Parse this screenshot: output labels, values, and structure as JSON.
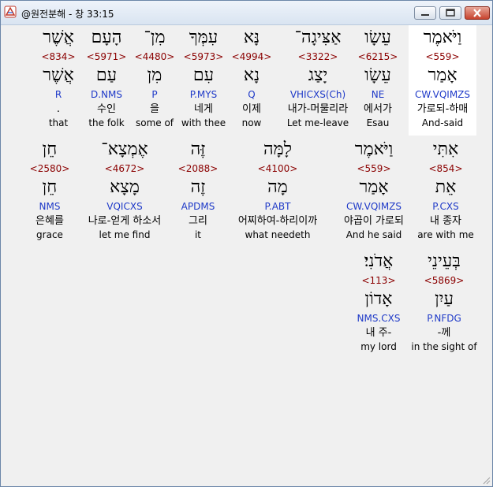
{
  "window": {
    "title": "@원전분해 - 창 33:15"
  },
  "rows": [
    {
      "words": [
        {
          "hebrew": "וַיֹּאמֶר",
          "strong": "<559>",
          "lemma": "אָמַר",
          "morph": "CW.VQIMZS",
          "korean": "가로되-하매",
          "english": "And-said",
          "highlight": true
        },
        {
          "hebrew": "עֵשָׂו",
          "strong": "<6215>",
          "lemma": "עֵשָׂו",
          "morph": "NE",
          "korean": "에서가",
          "english": "Esau",
          "highlight": false
        },
        {
          "hebrew": "אַצִּיגָה־",
          "strong": "<3322>",
          "lemma": "יָצַג",
          "morph": "VHICXS(Ch)",
          "korean": "내가-머물리라",
          "english": "Let me-leave",
          "highlight": false
        },
        {
          "hebrew": "נָּא",
          "strong": "<4994>",
          "lemma": "נָא",
          "morph": "Q",
          "korean": "이제",
          "english": "now",
          "highlight": false
        },
        {
          "hebrew": "עִמְּךָ",
          "strong": "<5973>",
          "lemma": "עִם",
          "morph": "P.MYS",
          "korean": "네게",
          "english": "with thee",
          "highlight": false
        },
        {
          "hebrew": "מִן־",
          "strong": "<4480>",
          "lemma": "מִן",
          "morph": "P",
          "korean": "을",
          "english": "some of",
          "highlight": false
        },
        {
          "hebrew": "הָעָם",
          "strong": "<5971>",
          "lemma": "עַם",
          "morph": "D.NMS",
          "korean": "수인",
          "english": "the folk",
          "highlight": false
        },
        {
          "hebrew": "אֲשֶׁר",
          "strong": "<834>",
          "lemma": "אֲשֶׁר",
          "morph": "R",
          "korean": ".",
          "english": "that",
          "highlight": false
        }
      ]
    },
    {
      "words": [
        {
          "hebrew": "אִתִּי",
          "strong": "<854>",
          "lemma": "אֵת",
          "morph": "P.CXS",
          "korean": "내 종자",
          "english": "are with me",
          "highlight": false
        },
        {
          "hebrew": "וַיֹּאמֶר",
          "strong": "<559>",
          "lemma": "אָמַר",
          "morph": "CW.VQIMZS",
          "korean": "야곱이 가로되",
          "english": "And he said",
          "highlight": false
        },
        {
          "hebrew": "לָמָּה",
          "strong": "<4100>",
          "lemma": "מָה",
          "morph": "P.ABT",
          "korean": "어찌하여-하리이까",
          "english": "what needeth",
          "highlight": false
        },
        {
          "hebrew": "זֶּה",
          "strong": "<2088>",
          "lemma": "זֶה",
          "morph": "APDMS",
          "korean": "그리",
          "english": "it",
          "highlight": false
        },
        {
          "hebrew": "אֶמְצָא־",
          "strong": "<4672>",
          "lemma": "מָצָא",
          "morph": "VQICXS",
          "korean": "나로-얻게 하소서",
          "english": "let me find",
          "highlight": false
        },
        {
          "hebrew": "חֵן",
          "strong": "<2580>",
          "lemma": "חֵן",
          "morph": "NMS",
          "korean": "은혜를",
          "english": "grace",
          "highlight": false
        }
      ]
    },
    {
      "words": [
        {
          "hebrew": "בְּעֵינֵי",
          "strong": "<5869>",
          "lemma": "עַיִן",
          "morph": "P.NFDG",
          "korean": "-께",
          "english": "in the sight of",
          "highlight": false
        },
        {
          "hebrew": "אֲדֹנִי׃",
          "strong": "<113>",
          "lemma": "אָדוֹן",
          "morph": "NMS.CXS",
          "korean": "내 주-",
          "english": "my lord",
          "highlight": false
        }
      ]
    }
  ]
}
